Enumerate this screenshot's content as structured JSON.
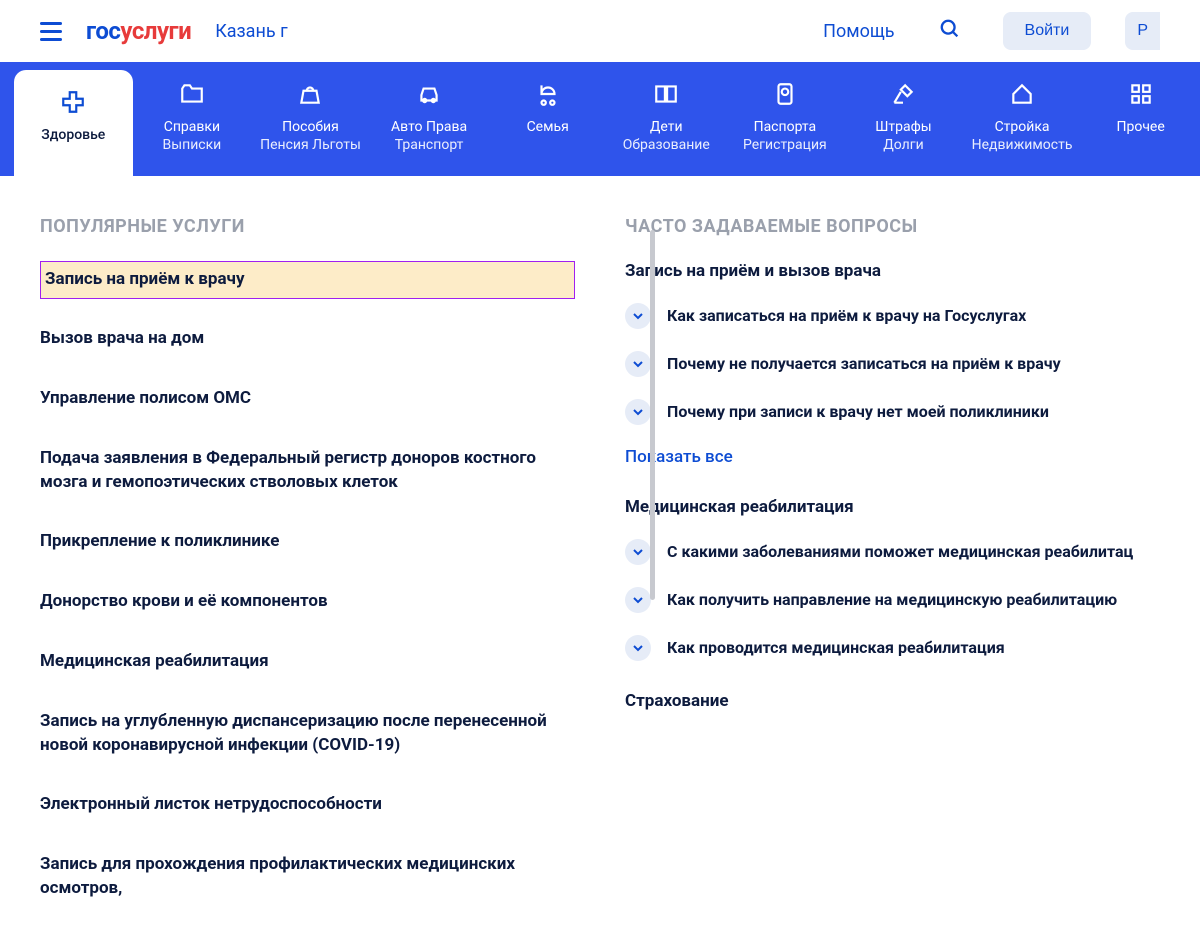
{
  "header": {
    "logo_part1": "гос",
    "logo_part2": "услуги",
    "region": "Казань г",
    "help": "Помощь",
    "login": "Войти",
    "register_partial": "Р"
  },
  "categories": [
    {
      "label1": "Здоровье",
      "label2": "",
      "icon": "health",
      "active": true
    },
    {
      "label1": "Справки",
      "label2": "Выписки",
      "icon": "folder"
    },
    {
      "label1": "Пособия",
      "label2": "Пенсия Льготы",
      "icon": "bag"
    },
    {
      "label1": "Авто Права",
      "label2": "Транспорт",
      "icon": "car"
    },
    {
      "label1": "Семья",
      "label2": "",
      "icon": "stroller"
    },
    {
      "label1": "Дети",
      "label2": "Образование",
      "icon": "book"
    },
    {
      "label1": "Паспорта",
      "label2": "Регистрация",
      "icon": "passport"
    },
    {
      "label1": "Штрафы",
      "label2": "Долги",
      "icon": "gavel"
    },
    {
      "label1": "Стройка",
      "label2": "Недвижимость",
      "icon": "house"
    },
    {
      "label1": "Прочее",
      "label2": "",
      "icon": "grid"
    }
  ],
  "popular": {
    "title": "ПОПУЛЯРНЫЕ УСЛУГИ",
    "items": [
      "Запись на приём к врачу",
      "Вызов врача на дом",
      "Управление полисом ОМС",
      "Подача заявления в Федеральный регистр доноров костного мозга и гемопоэтических стволовых клеток",
      "Прикрепление к поликлинике",
      "Донорство крови и её компонентов",
      "Медицинская реабилитация",
      "Запись на углубленную диспансеризацию после перенесенной новой коронавирусной инфекции (COVID-19)",
      "Электронный листок нетрудоспособности",
      "Запись для прохождения профилактических медицинских осмотров,"
    ]
  },
  "faq": {
    "title": "ЧАСТО ЗАДАВАЕМЫЕ ВОПРОСЫ",
    "show_all": "Показать все",
    "groups": [
      {
        "title": "Запись на приём и вызов врача",
        "items": [
          "Как записаться на приём к врачу на Госуслугах",
          "Почему не получается записаться на приём к врачу",
          "Почему при записи к врачу нет моей поликлиники"
        ]
      },
      {
        "title": "Медицинская реабилитация",
        "items": [
          "С какими заболеваниями поможет медицинская реабилитац",
          "Как получить направление на медицинскую реабилитацию",
          "Как проводится медицинская реабилитация"
        ]
      },
      {
        "title": "Страхование",
        "items": []
      }
    ]
  }
}
